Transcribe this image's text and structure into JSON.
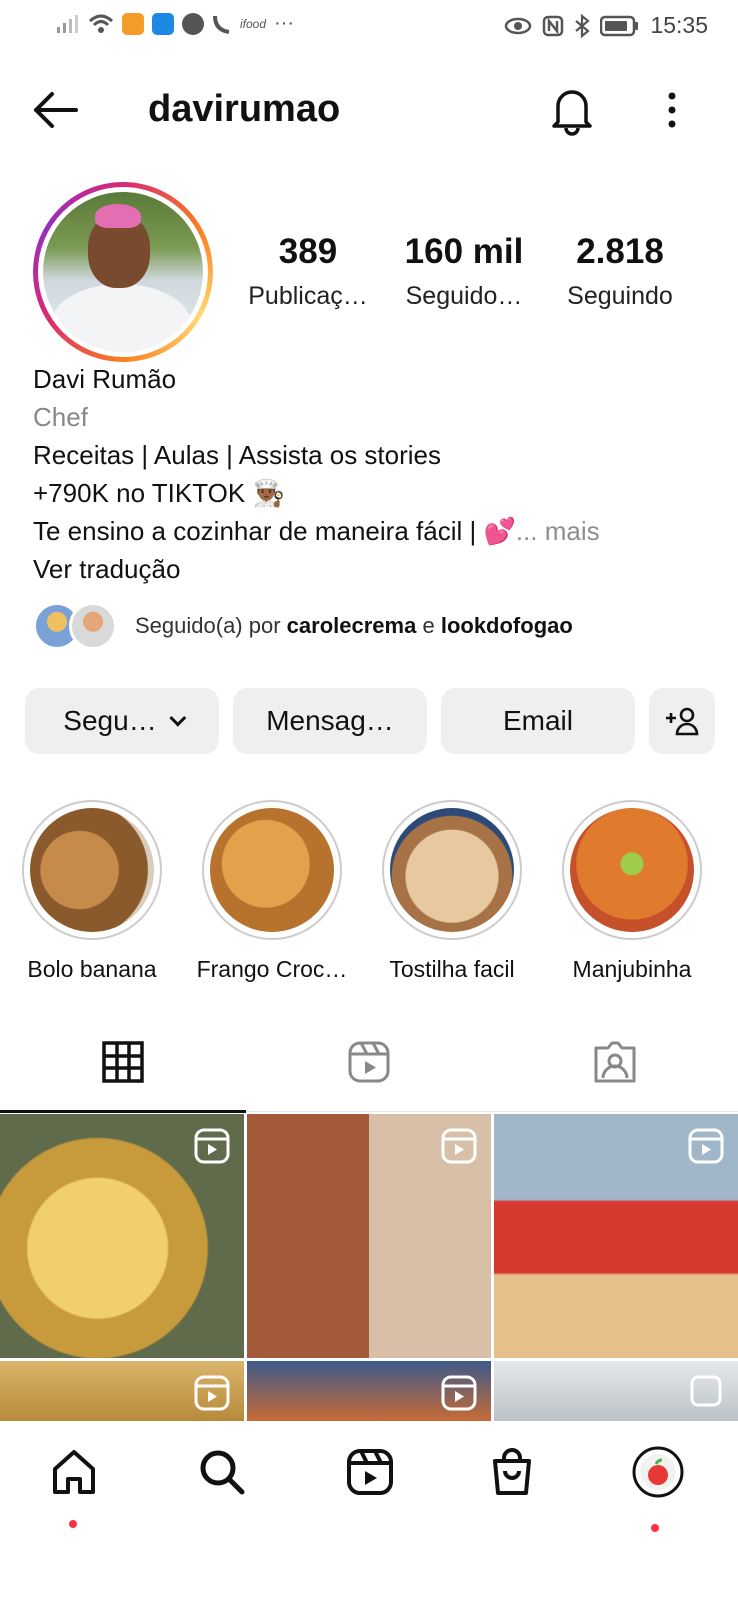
{
  "status_bar": {
    "time": "15:35",
    "icons_left": [
      "signal-icon",
      "wifi-icon",
      "app-notification-icon",
      "cloud-icon",
      "clock-app-icon",
      "phone-missed-icon",
      "ifood-icon",
      "more-notifications-icon"
    ],
    "icons_right": [
      "eye-icon",
      "nfc-icon",
      "bluetooth-icon",
      "battery-icon"
    ],
    "more": "···",
    "ifood": "ifood"
  },
  "header": {
    "username": "davirumao"
  },
  "stats": [
    {
      "value": "389",
      "label": "Publicaç…"
    },
    {
      "value": "160 mil",
      "label": "Seguido…"
    },
    {
      "value": "2.818",
      "label": "Seguindo"
    }
  ],
  "bio": {
    "name": "Davi Rumão",
    "category": "Chef",
    "line1": "Receitas | Aulas | Assista os stories",
    "line2": "+790K no TIKTOK 👨🏾‍🍳",
    "line3": "Te ensino a cozinhar de maneira fácil | 💕",
    "ellipsis": "...",
    "more": "mais",
    "translate": "Ver tradução"
  },
  "followed_by": {
    "prefix": "Seguido(a) por",
    "user1": "carolecrema",
    "conj": "e",
    "user2": "lookdofogao"
  },
  "actions": {
    "follow": "Segu…",
    "message": "Mensag…",
    "email": "Email"
  },
  "highlights": [
    {
      "label": "Bolo banana"
    },
    {
      "label": "Frango Croc…"
    },
    {
      "label": "Tostilha facil"
    },
    {
      "label": "Manjubinha"
    }
  ],
  "tabs": [
    "grid-icon",
    "reels-icon",
    "tagged-icon"
  ],
  "colors": {
    "accent_red": "#ff3040",
    "button_bg": "#efefef",
    "muted_text": "#8e8e8e"
  }
}
